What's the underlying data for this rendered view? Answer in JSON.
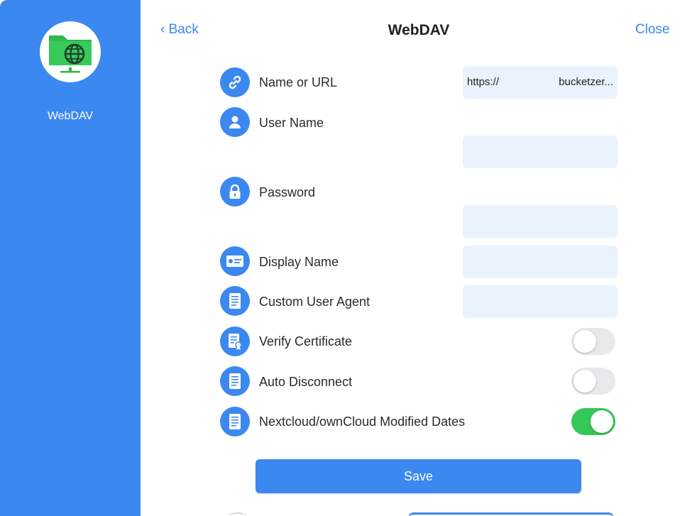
{
  "sidebar": {
    "label": "WebDAV",
    "icon": "folder-globe-icon"
  },
  "header": {
    "back_label": "‹ Back",
    "title": "WebDAV",
    "close_label": "Close"
  },
  "form": {
    "name_url": {
      "label": "Name or URL",
      "value_prefix": "https://",
      "value_suffix": "bucketzer..."
    },
    "user_name": {
      "label": "User Name",
      "value": ""
    },
    "password": {
      "label": "Password",
      "value": ""
    },
    "display_name": {
      "label": "Display Name",
      "value": ""
    },
    "custom_user_agent": {
      "label": "Custom User Agent",
      "value": ""
    },
    "verify_certificate": {
      "label": "Verify Certificate",
      "enabled": false
    },
    "auto_disconnect": {
      "label": "Auto Disconnect",
      "enabled": false
    },
    "modified_dates": {
      "label": "Nextcloud/ownCloud Modified Dates",
      "enabled": true
    },
    "save_label": "Save"
  },
  "colors": {
    "accent": "#3b88f0",
    "field_bg": "#eaf2fd",
    "toggle_on": "#34c759",
    "toggle_off": "#e9e9eb"
  }
}
